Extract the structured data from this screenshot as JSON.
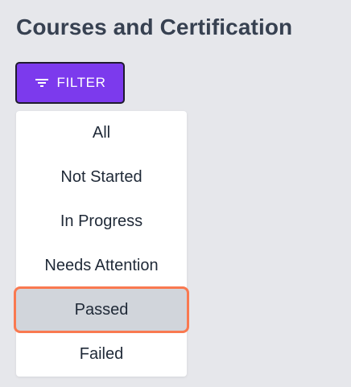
{
  "header": {
    "title": "Courses and Certification"
  },
  "filter_button": {
    "label": "FILTER",
    "icon": "filter-list-icon",
    "color": "#7c3aed"
  },
  "filter_menu": {
    "selected": "Passed",
    "highlight_color": "#f97950",
    "items": [
      {
        "label": "All"
      },
      {
        "label": "Not Started"
      },
      {
        "label": "In Progress"
      },
      {
        "label": "Needs Attention"
      },
      {
        "label": "Passed"
      },
      {
        "label": "Failed"
      }
    ]
  }
}
